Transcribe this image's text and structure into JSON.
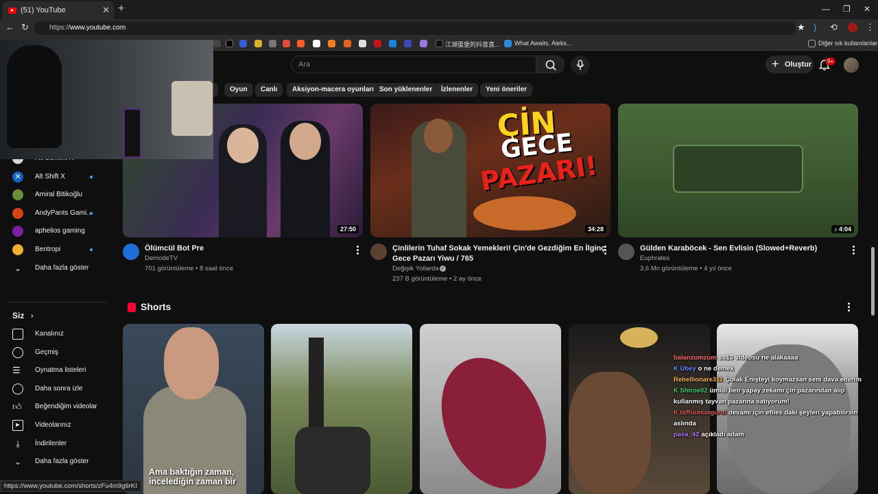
{
  "browser": {
    "tab_title": "(51) YouTube",
    "url_prefix": "https://",
    "url_host": "www.youtube.com",
    "bookmarks": [
      "江湖蛋堡的抖音直...",
      "What Awaits, Aleks...",
      "Diğer sık kullanılanlar"
    ],
    "status_url": "https://www.youtube.com/shorts/zFu4m9g6rKI"
  },
  "header": {
    "search_placeholder": "Ara",
    "create_label": "Oluştur",
    "notifications_badge": "9+"
  },
  "chips": [
    "Oyun",
    "Canlı",
    "Aksiyon-macera oyunları",
    "Son yüklenenler",
    "İzlenenler",
    "Yeni öneriler"
  ],
  "sidebar": {
    "subscriptions": [
      {
        "label": "Alt Schwift X",
        "dot": false
      },
      {
        "label": "Alt Shift X",
        "dot": true
      },
      {
        "label": "Amiral Bitikoğlu",
        "dot": false
      },
      {
        "label": "AndyPants Gami...",
        "dot": true
      },
      {
        "label": "aphelios gaming",
        "dot": false
      },
      {
        "label": "Bentropi",
        "dot": true
      }
    ],
    "show_more": "Daha fazla göster",
    "you_label": "Siz",
    "you_items": [
      "Kanalınız",
      "Geçmiş",
      "Oynatma listeleri",
      "Daha sonra izle",
      "Beğendiğim videolar",
      "Videolarınız",
      "İndirilenler",
      "Daha fazla göster"
    ]
  },
  "videos": [
    {
      "title": "Ölümcül Bot Pre",
      "channel": "DemodeTV",
      "meta": "701 görüntüleme • 8 saat önce",
      "duration": "27:50"
    },
    {
      "title_line1": "Çinlilerin Tuhaf Sokak Yemekleri! Çin'de Gezdiğim En İlginç",
      "title_line2": "Gece Pazarı Yiwu / 765",
      "channel": "Değişik Yollarda",
      "meta": "237 B görüntüleme • 2 ay önce",
      "duration": "34:28",
      "overlay": [
        "ÇİN",
        "GECE",
        "PAZARI!"
      ]
    },
    {
      "title": "Gülden Karaböcek - Sen Evlisin (Slowed+Reverb)",
      "channel": "Euphrates",
      "meta": "3,6 Mn görüntüleme • 4 yıl önce",
      "duration": "♪ 4:04"
    }
  ],
  "shorts": {
    "heading": "Shorts",
    "caption_line1": "Ama baktığın zaman,",
    "caption_line2": "incelediğin zaman bir"
  },
  "chat": [
    {
      "user": "balanzumzum",
      "text": "ss13 videosu ne alakaaaa",
      "color": "#ff6a6a"
    },
    {
      "user": "K Ubey",
      "text": "o ne demek",
      "color": "#5f8bff"
    },
    {
      "user": "Rebellionare311",
      "text": "Çolak Enişteyi koymazsan seni dava ederim",
      "color": "#f2b53c"
    },
    {
      "user": "K Shiroe02",
      "text": "ümidi ben yapay zekamı çin pazarından alıp",
      "color": "#3ecf6a"
    },
    {
      "user": "",
      "text": "kullanmış tayvan pazarına satıyorum!",
      "color": "#ffffff"
    },
    {
      "user": "K taffuunuogurul",
      "text": "devamı için efiles daki şeyleri yapabilirsin",
      "color": "#e45a5a"
    },
    {
      "user": "",
      "text": "aslında",
      "color": "#ffffff"
    },
    {
      "user": "pasa_42",
      "text": "açıkladı adam",
      "color": "#b07bff"
    }
  ]
}
